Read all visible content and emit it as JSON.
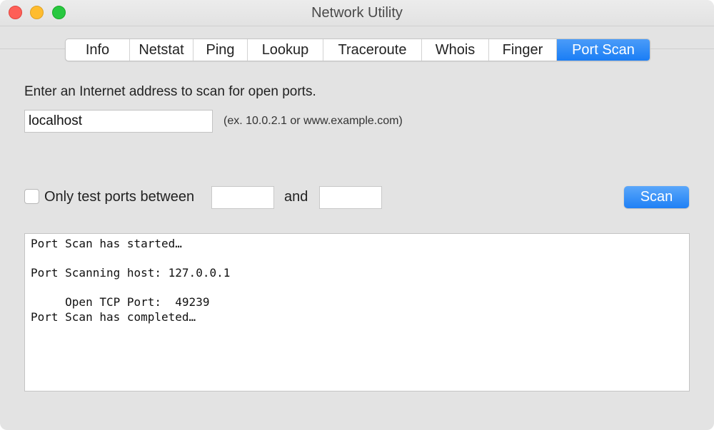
{
  "window": {
    "title": "Network Utility"
  },
  "tabs": [
    {
      "label": "Info",
      "width": 90
    },
    {
      "label": "Netstat",
      "width": 89
    },
    {
      "label": "Ping",
      "width": 76
    },
    {
      "label": "Lookup",
      "width": 106
    },
    {
      "label": "Traceroute",
      "width": 138
    },
    {
      "label": "Whois",
      "width": 94
    },
    {
      "label": "Finger",
      "width": 95
    },
    {
      "label": "Port Scan",
      "width": 130
    }
  ],
  "active_tab": "Port Scan",
  "form": {
    "prompt": "Enter an Internet address to scan for open ports.",
    "host_value": "localhost",
    "example": "(ex. 10.0.2.1 or www.example.com)",
    "only_test_label": "Only test ports between",
    "and_label": "and",
    "port_from": "",
    "port_to": "",
    "checkbox_checked": false,
    "scan_label": "Scan"
  },
  "output": {
    "lines": [
      "Port Scan has started…",
      "",
      "Port Scanning host: 127.0.0.1",
      "",
      "     Open TCP Port:  49239",
      "Port Scan has completed…"
    ]
  },
  "colors": {
    "accent": "#1a7df5",
    "window_bg": "#e3e3e3"
  }
}
